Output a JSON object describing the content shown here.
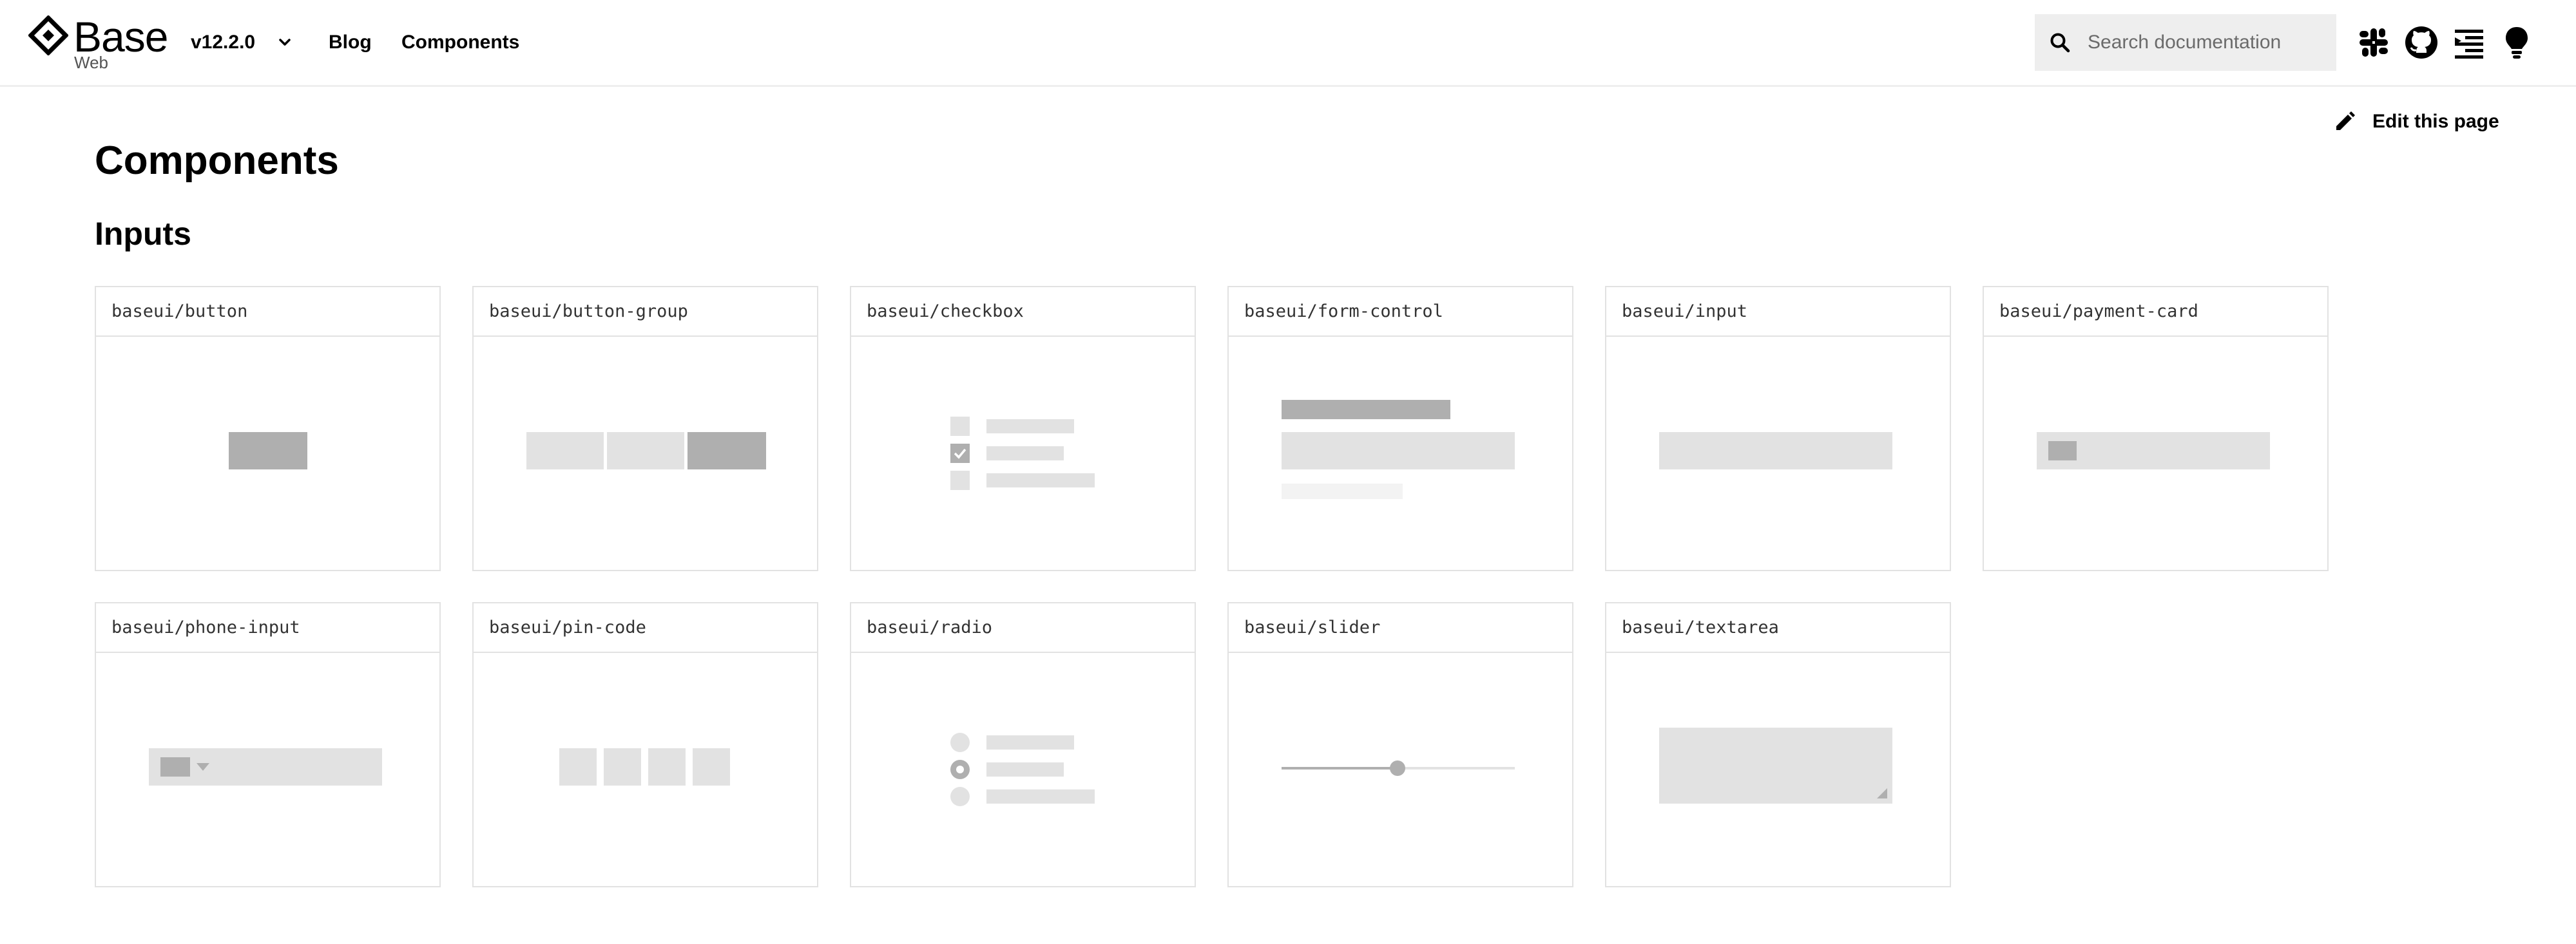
{
  "header": {
    "logo_text": "Base",
    "logo_sub": "Web",
    "version": "v12.2.0",
    "nav": [
      "Blog",
      "Components"
    ],
    "search_placeholder": "Search documentation",
    "icons": [
      "slack-icon",
      "github-icon",
      "rtl-toggle-icon",
      "theme-toggle-icon"
    ]
  },
  "page": {
    "edit_label": "Edit this page",
    "title": "Components",
    "section": "Inputs"
  },
  "cards": [
    "baseui/button",
    "baseui/button-group",
    "baseui/checkbox",
    "baseui/form-control",
    "baseui/input",
    "baseui/payment-card",
    "baseui/phone-input",
    "baseui/pin-code",
    "baseui/radio",
    "baseui/slider",
    "baseui/textarea"
  ],
  "colors": {
    "placeholder_light": "#e2e2e2",
    "placeholder_dark": "#afafaf",
    "border": "#e2e2e2",
    "search_bg": "#eeeeee"
  }
}
